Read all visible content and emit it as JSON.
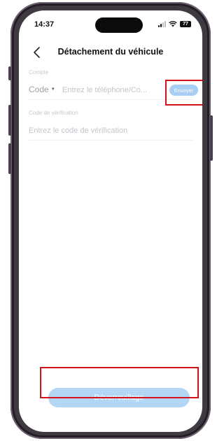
{
  "status_bar": {
    "time": "14:37",
    "battery": "77"
  },
  "nav": {
    "title": "Détachement du véhicule"
  },
  "form": {
    "account_label": "Compte",
    "country_code": "Code",
    "phone_placeholder": "Entrez le téléphone/Co...",
    "send_label": "Envoyer",
    "code_label": "Code de vérification",
    "code_placeholder": "Entrez le code de vérification"
  },
  "actions": {
    "unlock_label": "Déverrouillage"
  },
  "colors": {
    "accent": "#a9cef4",
    "highlight": "#d5121c",
    "frame": "#3f3942"
  }
}
